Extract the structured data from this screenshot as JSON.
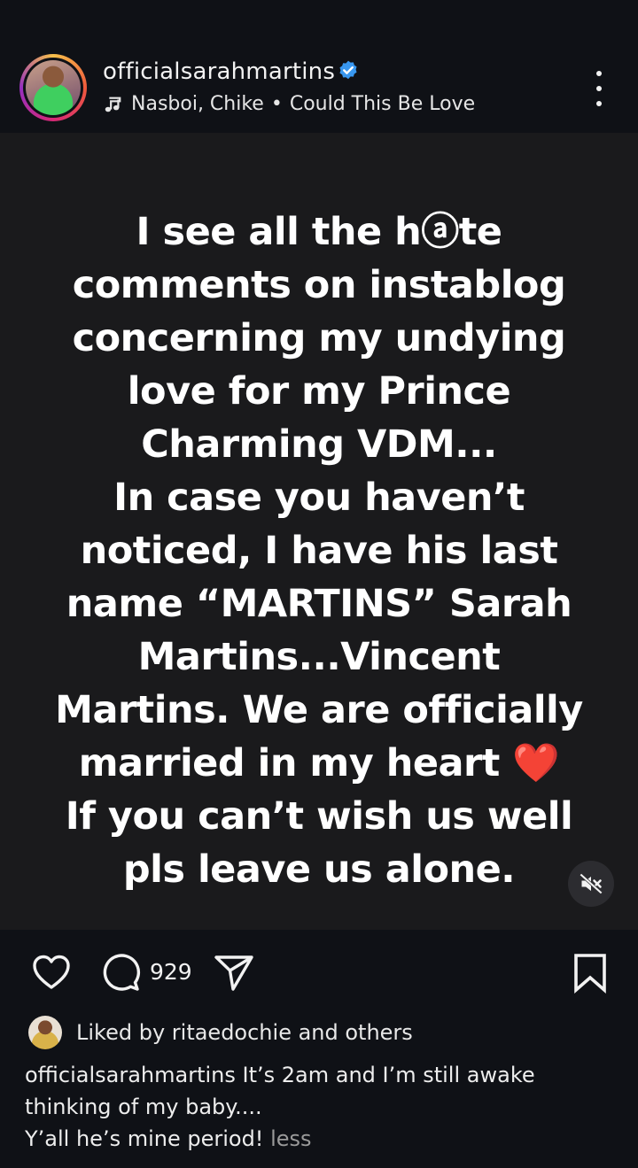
{
  "header": {
    "username": "officialsarahmartins",
    "verified": true,
    "music": {
      "artists": "Nasboi, Chike",
      "separator": "•",
      "song": "Could This Be Love"
    },
    "accent_colors": {
      "verified_badge": "#3897f0",
      "story_ring": [
        "#f7c04a",
        "#ef5a3c",
        "#d62976",
        "#962fbf"
      ]
    }
  },
  "post": {
    "lines": [
      "I see all the hⓐte",
      "comments on instablog",
      "concerning my undying",
      "love for my Prince",
      "Charming VDM...",
      "In case you haven’t",
      "noticed, I have his last",
      "name “MARTINS” Sarah",
      "Martins...Vincent",
      "Martins. We are officially",
      "married in my heart ❤️",
      "If you can’t wish us well",
      "pls leave us alone."
    ],
    "background": "#1a1a1c",
    "text_color": "#ffffff"
  },
  "actions": {
    "comment_count": "929"
  },
  "likes": {
    "text": "Liked by ritaedochie and others"
  },
  "caption": {
    "line1": "officialsarahmartins It’s 2am and I’m still awake",
    "line2": "thinking of my baby....",
    "line3": "Y’all he’s mine period!",
    "less_label": "less"
  },
  "icons": [
    "verified-badge-icon",
    "music-note-icon",
    "more-options-icon",
    "mute-icon",
    "heart-icon",
    "comment-icon",
    "share-icon",
    "bookmark-icon"
  ]
}
